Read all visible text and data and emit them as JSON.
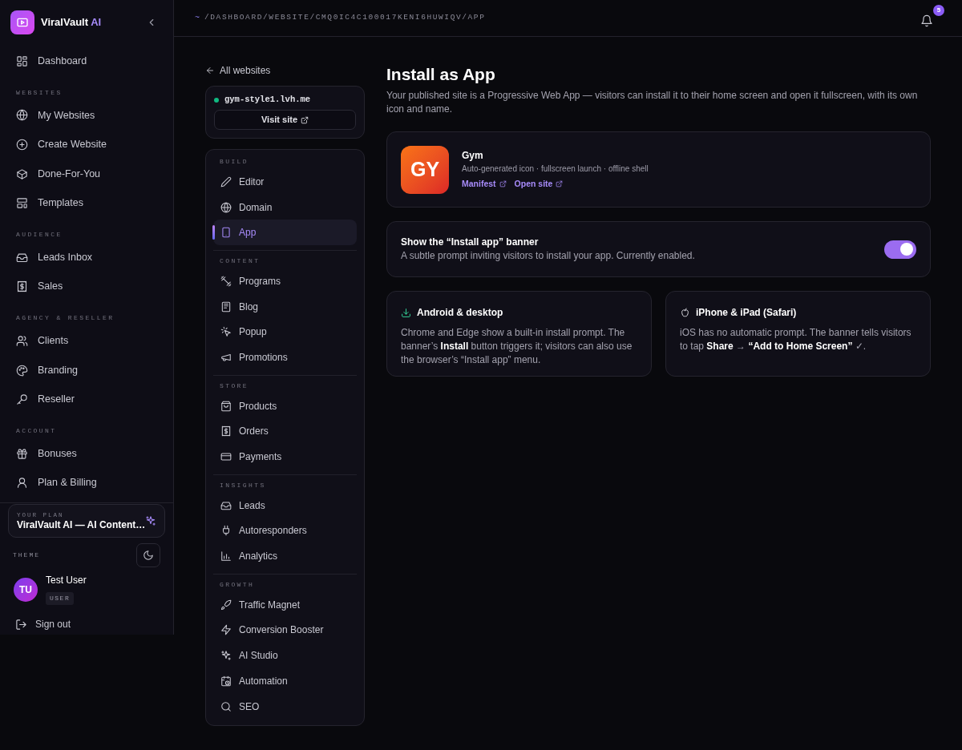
{
  "sidebar": {
    "brand": {
      "name": "ViralVault",
      "accent": "AI"
    },
    "sections": [
      {
        "items": [
          {
            "label": "Dashboard",
            "selected": false
          }
        ]
      },
      {
        "label": "WEBSITES",
        "items": [
          {
            "label": "My Websites",
            "selected": false
          },
          {
            "label": "Create Website",
            "selected": false
          },
          {
            "label": "Done-For-You",
            "selected": false
          },
          {
            "label": "Templates",
            "selected": false
          }
        ]
      },
      {
        "label": "AUDIENCE",
        "items": [
          {
            "label": "Leads Inbox",
            "selected": false
          },
          {
            "label": "Sales",
            "selected": false
          }
        ]
      },
      {
        "label": "AGENCY & RESELLER",
        "items": [
          {
            "label": "Clients",
            "selected": false
          },
          {
            "label": "Branding",
            "selected": false
          },
          {
            "label": "Reseller",
            "selected": false
          }
        ]
      },
      {
        "label": "ACCOUNT",
        "items": [
          {
            "label": "Bonuses",
            "selected": false
          },
          {
            "label": "Plan & Billing",
            "selected": false
          }
        ]
      }
    ],
    "plan": {
      "label": "YOUR PLAN",
      "name": "ViralVault AI — AI Content…"
    },
    "theme": {
      "label": "THEME"
    },
    "user": {
      "initials": "TU",
      "name": "Test User",
      "role": "USER"
    },
    "sign_out": "Sign out"
  },
  "topbar": {
    "prefix": "~",
    "breadcrumb": "/DASHBOARD/WEBSITE/CMQ0IC4C100017KENI6HUWIQV/APP",
    "notifications": "5"
  },
  "site_nav": {
    "back": "All websites",
    "site": {
      "domain": "gym-style1.lvh.me",
      "color": "#10b981"
    },
    "visit": "Visit site",
    "groups": [
      {
        "label": "BUILD",
        "items": [
          {
            "label": "Editor",
            "selected": false
          },
          {
            "label": "Domain",
            "selected": false
          },
          {
            "label": "App",
            "selected": true
          }
        ]
      },
      {
        "label": "CONTENT",
        "items": [
          {
            "label": "Programs",
            "selected": false
          },
          {
            "label": "Blog",
            "selected": false
          },
          {
            "label": "Popup",
            "selected": false
          },
          {
            "label": "Promotions",
            "selected": false
          }
        ]
      },
      {
        "label": "STORE",
        "items": [
          {
            "label": "Products",
            "selected": false
          },
          {
            "label": "Orders",
            "selected": false
          },
          {
            "label": "Payments",
            "selected": false
          }
        ]
      },
      {
        "label": "INSIGHTS",
        "items": [
          {
            "label": "Leads",
            "selected": false
          },
          {
            "label": "Autoresponders",
            "selected": false
          },
          {
            "label": "Analytics",
            "selected": false
          }
        ]
      },
      {
        "label": "GROWTH",
        "items": [
          {
            "label": "Traffic Magnet",
            "selected": false
          },
          {
            "label": "Conversion Booster",
            "selected": false
          },
          {
            "label": "AI Studio",
            "selected": false
          },
          {
            "label": "Automation",
            "selected": false
          },
          {
            "label": "SEO",
            "selected": false
          }
        ]
      }
    ]
  },
  "page": {
    "title": "Install as App",
    "description": "Your published site is a Progressive Web App — visitors can install it to their home screen and open it fullscreen, with its own icon and name.",
    "app": {
      "icon_text": "GY",
      "name": "Gym",
      "meta": "Auto-generated icon · fullscreen launch · offline shell",
      "links": [
        "Manifest",
        "Open site"
      ]
    },
    "banner_setting": {
      "title": "Show the “Install app” banner",
      "description": "A subtle prompt inviting visitors to install your app. Currently enabled.",
      "on": true
    },
    "platforms": [
      {
        "kind": "android",
        "title": "Android & desktop",
        "body": "Chrome and Edge show a built-in install prompt. The banner’s **Install** button triggers it; visitors can also use the browser’s “Install app” menu."
      },
      {
        "kind": "ios",
        "title": "iPhone & iPad (Safari)",
        "body": "iOS has no automatic prompt. The banner tells visitors to tap **Share** → **“Add to Home Screen”** ✓."
      }
    ]
  }
}
